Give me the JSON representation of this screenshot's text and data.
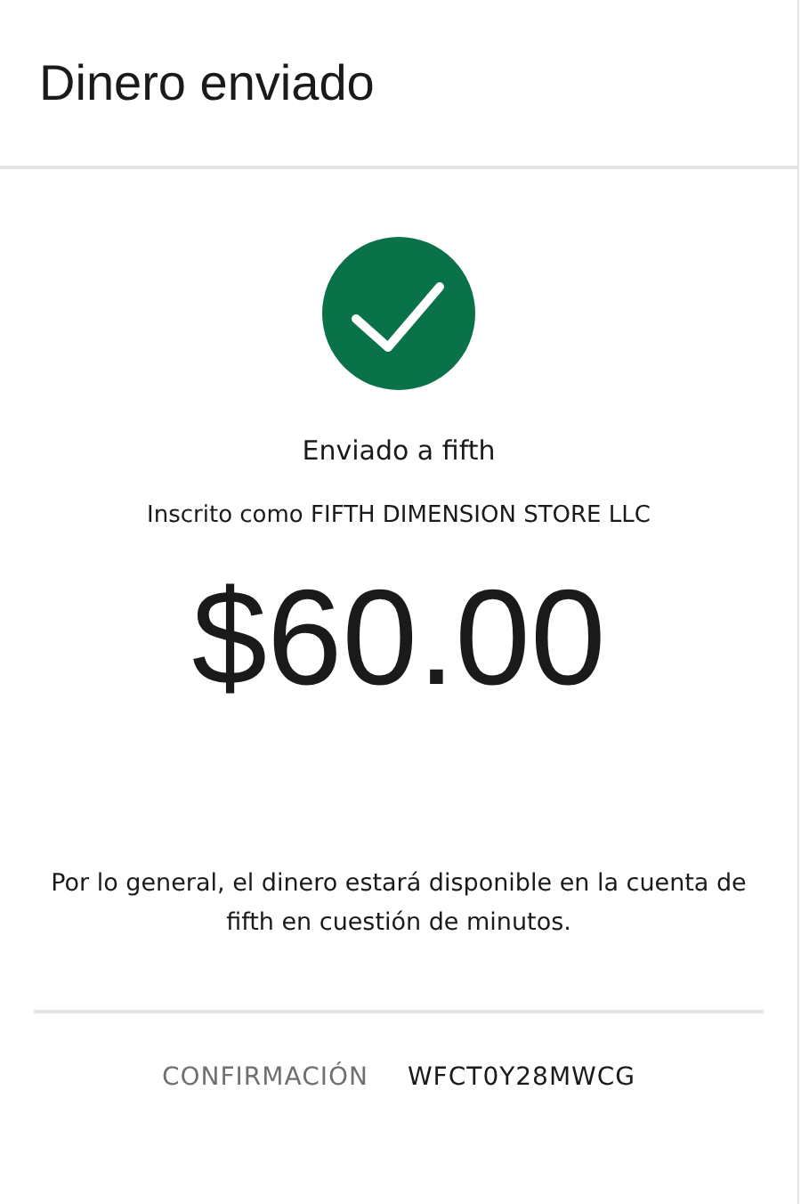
{
  "header": {
    "title": "Dinero enviado"
  },
  "receipt": {
    "recipient": "Enviado a fifth",
    "enrolled_as": "Inscrito como FIFTH DIMENSION STORE LLC",
    "amount": "$60.00",
    "note": "Por lo general, el dinero estará disponible en la cuenta de fifth en cuestión de minutos.",
    "confirmation": {
      "label": "CONFIRMACIÓN",
      "value": "WFCT0Y28MWCG"
    }
  }
}
